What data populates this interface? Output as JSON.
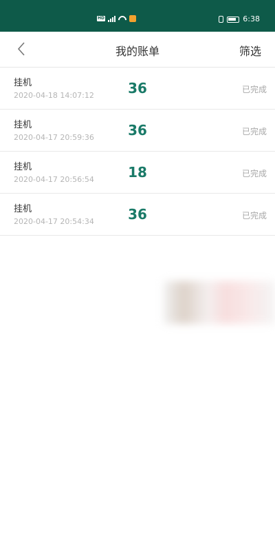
{
  "status_bar": {
    "hd_badge": "HD",
    "network": "4G",
    "time": "6:38",
    "background_color": "#0e5a49"
  },
  "nav": {
    "title": "我的账单",
    "filter_label": "筛选",
    "back_icon": "chevron-left-icon"
  },
  "bills": [
    {
      "type": "挂机",
      "time": "2020-04-18 14:07:12",
      "amount": "36",
      "status": "已完成"
    },
    {
      "type": "挂机",
      "time": "2020-04-17 20:59:36",
      "amount": "36",
      "status": "已完成"
    },
    {
      "type": "挂机",
      "time": "2020-04-17 20:56:54",
      "amount": "18",
      "status": "已完成"
    },
    {
      "type": "挂机",
      "time": "2020-04-17 20:54:34",
      "amount": "36",
      "status": "已完成"
    }
  ],
  "colors": {
    "amount": "#1a7a68",
    "status": "#a8a8a8"
  }
}
